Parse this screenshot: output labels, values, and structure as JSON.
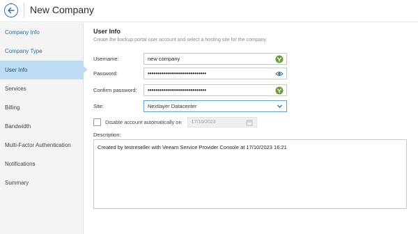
{
  "header": {
    "title": "New Company"
  },
  "sidebar": {
    "items": [
      {
        "label": "Company Info"
      },
      {
        "label": "Company Type"
      },
      {
        "label": "User Info"
      },
      {
        "label": "Services"
      },
      {
        "label": "Billing"
      },
      {
        "label": "Bandwidth"
      },
      {
        "label": "Multi-Factor Authentication"
      },
      {
        "label": "Notifications"
      },
      {
        "label": "Summary"
      }
    ]
  },
  "main": {
    "title": "User Info",
    "subtitle": "Create the backup portal user account and select a hosting site for the company.",
    "username": {
      "label": "Username:",
      "value": "new company"
    },
    "password": {
      "label": "Password:",
      "value": "••••••••••••••••••••••••••••••"
    },
    "confirm_password": {
      "label": "Confirm password:",
      "value": "••••••••••••••••••••••••••••••"
    },
    "site": {
      "label": "Site:",
      "value": "Nextlayer Datacenter"
    },
    "disable_account": {
      "label": "Disable account automatically on",
      "checked": false,
      "date": "17/10/2023"
    },
    "description": {
      "label": "Description:",
      "value": "Created by testreseller with Veeam Service Provider Console at 17/10/2023 16:21"
    }
  },
  "colors": {
    "accent": "#2f6f9f",
    "active_item": "#bcdcf3",
    "valid_icon": "#6a9a3a"
  },
  "icons": [
    "back-arrow-icon",
    "password-valid-icon",
    "show-password-icon",
    "chevron-down-icon",
    "calendar-icon"
  ]
}
